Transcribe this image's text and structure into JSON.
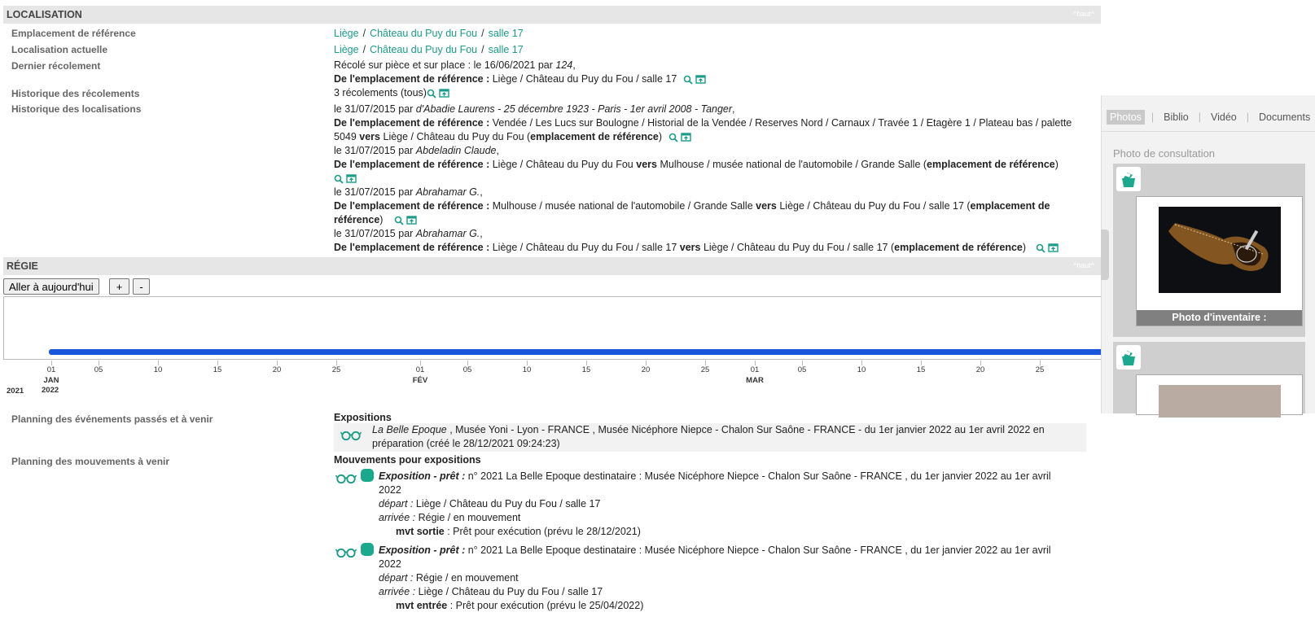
{
  "localisation": {
    "title": "LOCALISATION",
    "haut": "^haut^",
    "labels": {
      "emplacement": "Emplacement de référence",
      "actuelle": "Localisation actuelle",
      "dernier": "Dernier récolement",
      "hist_recol": "Historique des récolements",
      "hist_loc": "Historique des localisations"
    },
    "path": {
      "city": "Liège",
      "place": "Château du Puy du Fou",
      "room": "salle 17"
    },
    "dernier": {
      "line1_prefix": "Récolé sur pièce et sur place : le 16/06/2021 par ",
      "line1_by": "124",
      "line1_suffix": ",",
      "line2_bold": "De l'emplacement de référence :",
      "line2_text": " Liège / Château du Puy du Fou / salle 17"
    },
    "hist_recol_text": "3 récolements (tous)",
    "history": {
      "e1_prefix": "le 31/07/2015 par ",
      "e1_by": "d'Abadie Laurens - 25 décembre 1923 - Paris - 1er avril 2008 - Tanger",
      "e1_from_bold": "De l'emplacement de référence :",
      "e1_from": " Vendée / Les Lucs sur Boulogne / Historial de la Vendée / Reserves Nord / Carnaux / Travée 1 / Etagère 1 / Plateau bas / palette",
      "e1_from2": "5049 ",
      "vers": "vers",
      "e1_to": " Liège / Château du Puy du Fou  (",
      "ref_bold": "emplacement de référence",
      "close": ")",
      "e2_prefix": "le 31/07/2015 par ",
      "e2_by": "Abdeladin Claude",
      "e2_from": " Liège / Château du Puy du Fou ",
      "e2_to": " Mulhouse / musée national de l'automobile / Grande Salle  (",
      "e3_prefix": "le 31/07/2015 par ",
      "e3_by": "Abrahamar G.",
      "e3_from": " Mulhouse / musée national de l'automobile / Grande Salle ",
      "e3_to": " Liège / Château du Puy du Fou / salle 17  (",
      "ref_bold_a": "emplacement de",
      "ref_bold_b": "référence",
      "e4_prefix": "le 31/07/2015 par ",
      "e4_by": "Abrahamar G.",
      "e4_from": " Liège / Château du Puy du Fou / salle 17 ",
      "e4_to": " Liège / Château du Puy du Fou / salle 17  ("
    }
  },
  "regie": {
    "title": "RÉGIE",
    "haut": "^haut^",
    "buttons": {
      "today": "Aller à aujourd'hui",
      "plus": "+",
      "minus": "-"
    },
    "timeline": {
      "ticks": [
        "01",
        "05",
        "10",
        "15",
        "20",
        "25",
        "01",
        "05",
        "10",
        "15",
        "20",
        "25",
        "01",
        "05",
        "10",
        "15",
        "20",
        "25"
      ],
      "months": [
        "JAN",
        "FÉV",
        "MAR"
      ],
      "year_row": [
        "2021",
        "2022"
      ]
    },
    "labels": {
      "planning_events": "Planning des événements passés et à venir",
      "planning_moves": "Planning des mouvements à venir"
    },
    "expositions_title": "Expositions",
    "expo": {
      "name": "La Belle Epoque",
      "text": " , Musée Yoni - Lyon - FRANCE ,  Musée Nicéphore Niepce - Chalon Sur Saône - FRANCE - du 1er janvier 2022 au 1er avril 2022  en",
      "text2": "préparation (créé le 28/12/2021 09:24:23)"
    },
    "mouvements_title": "Mouvements pour expositions",
    "moves": [
      {
        "kind": "Exposition - prêt :",
        "desc": " n° 2021 La Belle Epoque destinataire : Musée Nicéphore Niepce - Chalon Sur Saône - FRANCE , du 1er janvier 2022 au 1er avril",
        "desc2": "2022",
        "depart_lbl": "départ :",
        "depart": " Liège / Château du Puy du Fou / salle 17",
        "arrivee_lbl": "arrivée :",
        "arrivee": " Régie / en mouvement",
        "mvt_bold": "mvt sortie",
        "mvt": " : Prêt pour exécution (prévu le 28/12/2021)"
      },
      {
        "kind": "Exposition - prêt :",
        "desc": " n° 2021 La Belle Epoque destinataire : Musée Nicéphore Niepce - Chalon Sur Saône - FRANCE , du 1er janvier 2022 au 1er avril",
        "desc2": "2022",
        "depart_lbl": "départ :",
        "depart": " Régie / en mouvement",
        "arrivee_lbl": "arrivée :",
        "arrivee": " Liège / Château du Puy du Fou / salle 17",
        "mvt_bold": "mvt entrée",
        "mvt": " : Prêt pour exécution (prévu le 25/04/2022)"
      }
    ]
  },
  "side_panel": {
    "tabs": [
      "Photos",
      "Biblio",
      "Vidéo",
      "Documents"
    ],
    "active_tab": "Photos",
    "title": "Photo de consultation",
    "caption": "Photo d'inventaire :"
  },
  "colors": {
    "link": "#1a9c87",
    "accent": "#1aa98d",
    "timeline_bar": "#1a56db",
    "header_bg": "#e6e6e6"
  }
}
